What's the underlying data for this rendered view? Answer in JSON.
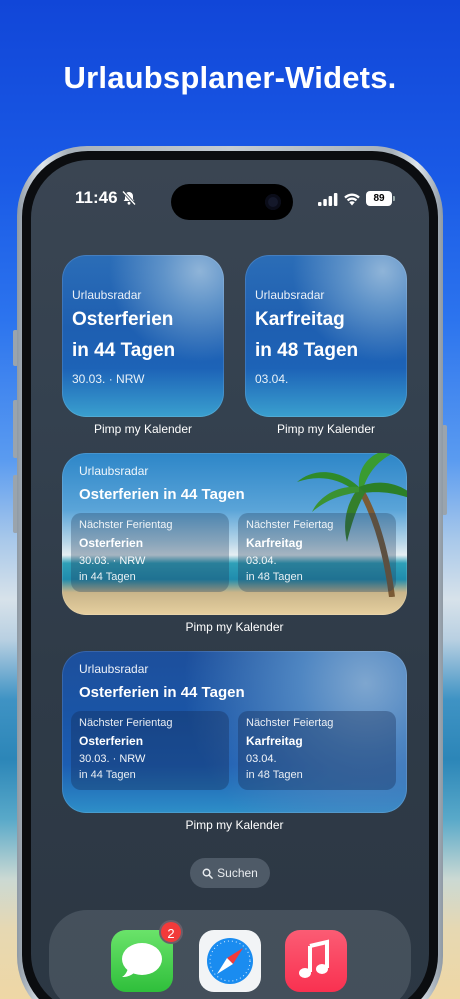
{
  "headline": "Urlaubsplaner-Widets.",
  "status_bar": {
    "time": "11:46",
    "battery": "89"
  },
  "widget_small_1": {
    "app_name": "Urlaubsradar",
    "line1": "Osterferien",
    "line2": "in 44 Tagen",
    "sub": "30.03. · NRW",
    "label": "Pimp my Kalender"
  },
  "widget_small_2": {
    "app_name": "Urlaubsradar",
    "line1": "Karfreitag",
    "line2": "in 48 Tagen",
    "sub": "03.04.",
    "label": "Pimp my Kalender"
  },
  "widget_medium_1": {
    "app_name": "Urlaubsradar",
    "title": "Osterferien in 44 Tagen",
    "left": {
      "heading": "Nächster Ferientag",
      "name": "Osterferien",
      "date": "30.03. · NRW",
      "countdown": "in 44 Tagen"
    },
    "right": {
      "heading": "Nächster Feiertag",
      "name": "Karfreitag",
      "date": "03.04.",
      "countdown": "in 48 Tagen"
    },
    "label": "Pimp my Kalender"
  },
  "widget_medium_2": {
    "app_name": "Urlaubsradar",
    "title": "Osterferien in 44 Tagen",
    "left": {
      "heading": "Nächster Ferientag",
      "name": "Osterferien",
      "date": "30.03. · NRW",
      "countdown": "in 44 Tagen"
    },
    "right": {
      "heading": "Nächster Feiertag",
      "name": "Karfreitag",
      "date": "03.04.",
      "countdown": "in 48 Tagen"
    },
    "label": "Pimp my Kalender"
  },
  "search": {
    "label": "Suchen",
    "icon": "search-icon"
  },
  "dock": {
    "apps": [
      {
        "name": "messages-icon",
        "badge": "2"
      },
      {
        "name": "safari-icon"
      },
      {
        "name": "music-icon"
      }
    ]
  },
  "colors": {
    "sky_top": "#1146d8",
    "badge_red": "#f23a3a",
    "messages_green": "#2fbf3b",
    "music_red": "#f93150"
  }
}
